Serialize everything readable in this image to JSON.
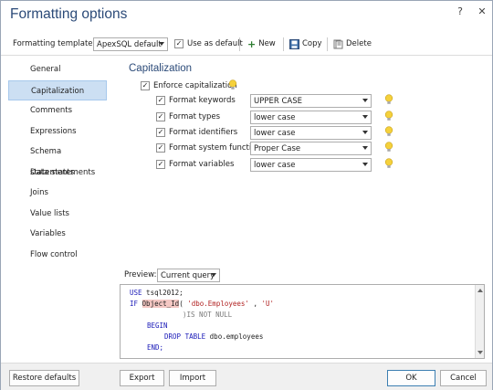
{
  "window": {
    "title": "Formatting options",
    "help_glyph": "?",
    "close_glyph": "✕"
  },
  "toolbar": {
    "template_label": "Formatting template:",
    "template_value": "ApexSQL default",
    "use_as_default": "Use as default",
    "use_as_default_checked": true,
    "new_label": "New",
    "copy_label": "Copy",
    "delete_label": "Delete"
  },
  "nav": {
    "items": [
      "General",
      "Capitalization",
      "Comments",
      "Expressions",
      "Schema statements",
      "Data statements",
      "Joins",
      "Value lists",
      "Variables",
      "Flow control"
    ],
    "selected": "Capitalization"
  },
  "capitalization": {
    "heading": "Capitalization",
    "enforce_label": "Enforce capitalization",
    "enforce_checked": true,
    "options": [
      {
        "label": "Format keywords",
        "value": "UPPER CASE",
        "checked": true
      },
      {
        "label": "Format types",
        "value": "lower case",
        "checked": true
      },
      {
        "label": "Format identifiers",
        "value": "lower case",
        "checked": true
      },
      {
        "label": "Format system functions",
        "value": "Proper Case",
        "checked": true
      },
      {
        "label": "Format variables",
        "value": "lower case",
        "checked": true
      }
    ]
  },
  "preview": {
    "label": "Preview:",
    "query_value": "Current query",
    "lines": [
      "USE tsql2012;",
      "IF Object_Id( 'dbo.Employees' , 'U'",
      ")IS NOT NULL",
      "BEGIN",
      "DROP TABLE dbo.employees",
      "END;"
    ]
  },
  "footer": {
    "restore": "Restore defaults",
    "export": "Export",
    "import": "Import",
    "ok": "OK",
    "cancel": "Cancel"
  },
  "colors": {
    "accent": "#2b4a78",
    "selection": "#ccdff3",
    "keyword": "#1a1ab8",
    "string": "#b12222",
    "highlight": "#f4c7c3",
    "bulb": "#f5d13c"
  }
}
